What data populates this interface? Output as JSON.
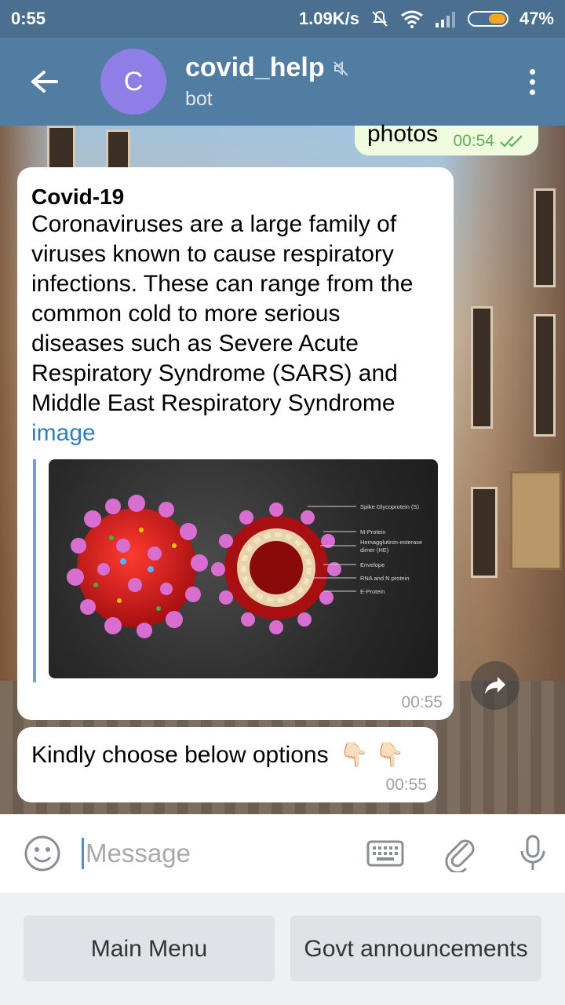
{
  "status_bar": {
    "time": "0:55",
    "network_speed": "1.09K/s",
    "battery_percent": "47%",
    "battery_level": 0.47,
    "icons": [
      "mute-icon",
      "wifi-icon",
      "signal-icon",
      "battery-icon"
    ]
  },
  "header": {
    "avatar_letter": "C",
    "title": "covid_help",
    "subtitle": "bot",
    "colors": {
      "header": "#517da2",
      "avatar": "#8e7ee6"
    }
  },
  "messages": {
    "outgoing": {
      "text": "photos",
      "time": "00:54"
    },
    "info": {
      "title": "Covid-19",
      "body": "Coronaviruses are a large family of viruses known to cause respiratory infections. These can range from the common cold to more serious diseases such as Severe Acute Respiratory Syndrome (SARS) and Middle East Respiratory Syndrome",
      "link": "image",
      "time": "00:55",
      "image_labels": [
        "Spike Glycoprotein (S)",
        "M-Protein",
        "Hemagglutinin-esterase dimer (HE)",
        "Envelope",
        "RNA and N protein",
        "E-Protein"
      ]
    },
    "options": {
      "text": "Kindly choose below options",
      "hands": "👇🏻 👇🏻",
      "time": "00:55"
    }
  },
  "input": {
    "placeholder": "Message"
  },
  "keyboard": {
    "buttons": [
      "Main Menu",
      "Govt announcements"
    ]
  }
}
